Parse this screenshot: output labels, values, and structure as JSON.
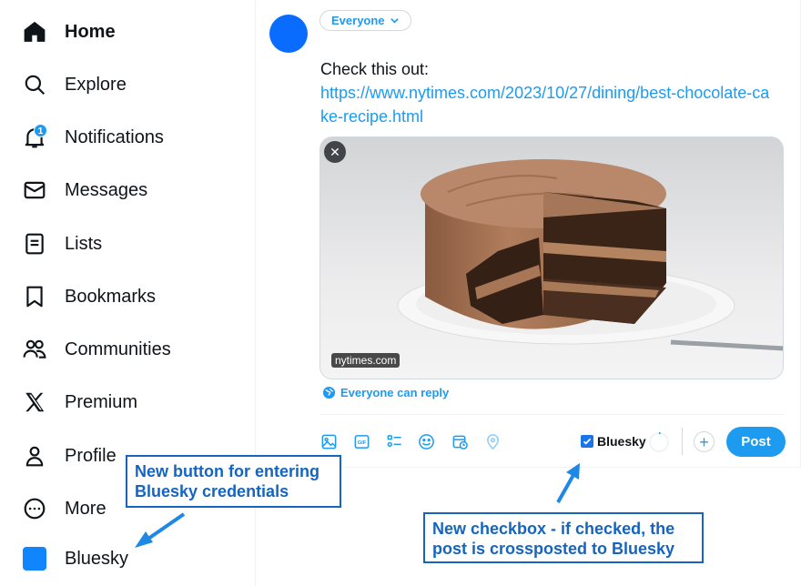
{
  "sidebar": {
    "items": [
      {
        "id": "home",
        "label": "Home",
        "icon": "home-icon"
      },
      {
        "id": "explore",
        "label": "Explore",
        "icon": "search-icon"
      },
      {
        "id": "notifications",
        "label": "Notifications",
        "icon": "bell-icon",
        "badge": "1"
      },
      {
        "id": "messages",
        "label": "Messages",
        "icon": "envelope-icon"
      },
      {
        "id": "lists",
        "label": "Lists",
        "icon": "list-icon"
      },
      {
        "id": "bookmarks",
        "label": "Bookmarks",
        "icon": "bookmark-icon"
      },
      {
        "id": "communities",
        "label": "Communities",
        "icon": "people-icon"
      },
      {
        "id": "premium",
        "label": "Premium",
        "icon": "x-logo-icon"
      },
      {
        "id": "profile",
        "label": "Profile",
        "icon": "person-icon"
      },
      {
        "id": "more",
        "label": "More",
        "icon": "more-circle-icon"
      },
      {
        "id": "bluesky",
        "label": "Bluesky",
        "icon": "bluesky-square-icon"
      }
    ]
  },
  "compose": {
    "audience": "Everyone",
    "text": "Check this out:",
    "link": "https://www.nytimes.com/2023/10/27/dining/best-chocolate-cake-recipe.html",
    "media_source": "nytimes.com",
    "close_symbol": "✕",
    "reply_setting": "Everyone can reply",
    "bluesky_checkbox_label": "Bluesky",
    "bluesky_checked": true,
    "add_symbol": "+",
    "post_label": "Post",
    "toolbar_icons": [
      "image-icon",
      "gif-icon",
      "poll-icon",
      "emoji-icon",
      "schedule-icon",
      "location-icon"
    ]
  },
  "annotations": {
    "note1": "New button for entering Bluesky credentials",
    "note2": "New checkbox - if checked, the post is crossposted to Bluesky"
  },
  "colors": {
    "accent": "#1d9bf0",
    "avatar": "#0a6cff",
    "bluesky": "#1185fe",
    "annotation": "#1565c0"
  }
}
